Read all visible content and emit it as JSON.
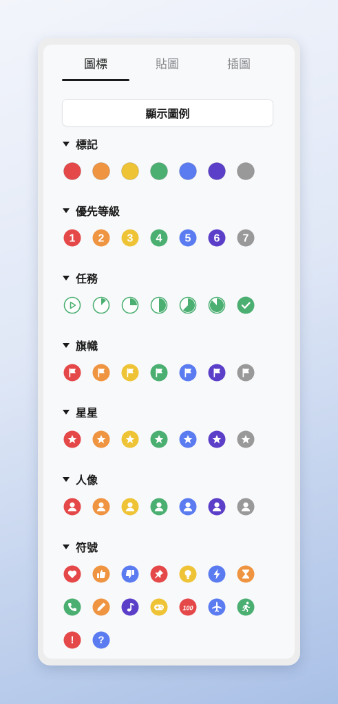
{
  "tabs": [
    {
      "label": "圖標",
      "active": true
    },
    {
      "label": "貼圖",
      "active": false
    },
    {
      "label": "插圖",
      "active": false
    }
  ],
  "legend_button": "顯示圖例",
  "colors": {
    "red": "#e54848",
    "orange": "#ef9440",
    "yellow": "#eec336",
    "green": "#4caf72",
    "blue": "#5b7cf0",
    "purple": "#5b3fc8",
    "gray": "#999999"
  },
  "sections": [
    {
      "title": "標記",
      "kind": "dot",
      "icons": [
        "red-dot-icon",
        "orange-dot-icon",
        "yellow-dot-icon",
        "green-dot-icon",
        "blue-dot-icon",
        "purple-dot-icon",
        "gray-dot-icon"
      ]
    },
    {
      "title": "優先等級",
      "kind": "number",
      "numbers": [
        "1",
        "2",
        "3",
        "4",
        "5",
        "6",
        "7"
      ]
    },
    {
      "title": "任務",
      "kind": "progress",
      "icons": [
        "task-start-icon",
        "task-progress-12-icon",
        "task-progress-25-icon",
        "task-progress-50-icon",
        "task-progress-62-icon",
        "task-progress-87-icon",
        "task-done-icon"
      ]
    },
    {
      "title": "旗幟",
      "kind": "flag"
    },
    {
      "title": "星星",
      "kind": "star"
    },
    {
      "title": "人像",
      "kind": "person"
    },
    {
      "title": "符號",
      "kind": "symbol",
      "symbols": [
        {
          "name": "heart-icon",
          "color": "red"
        },
        {
          "name": "thumbs-up-icon",
          "color": "orange"
        },
        {
          "name": "thumbs-down-icon",
          "color": "blue"
        },
        {
          "name": "pin-icon",
          "color": "red"
        },
        {
          "name": "lightbulb-icon",
          "color": "yellow"
        },
        {
          "name": "lightning-icon",
          "color": "blue"
        },
        {
          "name": "hourglass-icon",
          "color": "orange"
        },
        {
          "name": "phone-icon",
          "color": "green"
        },
        {
          "name": "pencil-icon",
          "color": "orange"
        },
        {
          "name": "music-note-icon",
          "color": "purple"
        },
        {
          "name": "gamepad-icon",
          "color": "yellow"
        },
        {
          "name": "hundred-icon",
          "color": "red",
          "text": "100"
        },
        {
          "name": "airplane-icon",
          "color": "blue"
        },
        {
          "name": "running-icon",
          "color": "green"
        },
        {
          "name": "exclamation-icon",
          "color": "red",
          "text": "!"
        },
        {
          "name": "question-icon",
          "color": "blue",
          "text": "?"
        }
      ]
    }
  ]
}
